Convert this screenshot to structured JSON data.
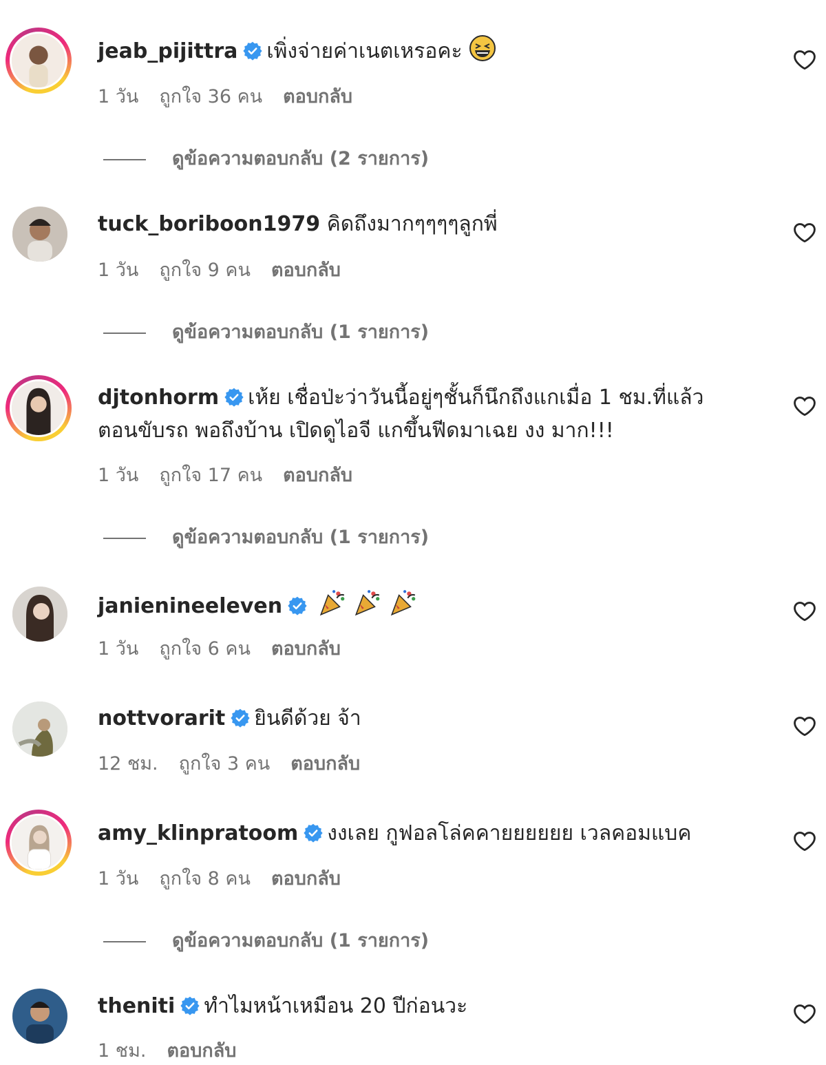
{
  "labels": {
    "reply": "ตอบกลับ"
  },
  "comments": [
    {
      "username": "jeab_pijittra",
      "verified": true,
      "text": "เพิ่งจ่ายค่าเนตเหรอคะ",
      "emoji": "laughing-tears",
      "time": "1 วัน",
      "likes": "ถูกใจ 36 คน",
      "replies": "ดูข้อความตอบกลับ (2 รายการ)"
    },
    {
      "username": "tuck_boriboon1979",
      "verified": false,
      "text": "คิดถึงมากๆๆๆๆลูกพี่",
      "time": "1 วัน",
      "likes": "ถูกใจ 9 คน",
      "replies": "ดูข้อความตอบกลับ (1 รายการ)"
    },
    {
      "username": "djtonhorm",
      "verified": true,
      "text": "เห้ย เชื่อป่ะว่าวันนี้อยู่ๆชั้นก็นึกถึงแกเมื่อ 1 ชม.ที่แล้ว",
      "text2": "ตอนขับรถ พอถึงบ้าน เปิดดูไอจี แกขึ้นฟีดมาเฉย งง มาก!!!",
      "time": "1 วัน",
      "likes": "ถูกใจ 17 คน",
      "replies": "ดูข้อความตอบกลับ (1 รายการ)"
    },
    {
      "username": "janienineeleven",
      "verified": true,
      "emoji": "party-popper x3",
      "time": "1 วัน",
      "likes": "ถูกใจ 6 คน"
    },
    {
      "username": "nottvorarit",
      "verified": true,
      "text": "ยินดีด้วย จ้า",
      "time": "12 ชม.",
      "likes": "ถูกใจ 3 คน"
    },
    {
      "username": "amy_klinpratoom",
      "verified": true,
      "text": "งงเลย กูฟอลโล่คคายยยยยย เวลคอมแบค",
      "time": "1 วัน",
      "likes": "ถูกใจ 8 คน",
      "replies": "ดูข้อความตอบกลับ (1 รายการ)"
    },
    {
      "username": "theniti",
      "verified": true,
      "text": "ทำไมหน้าเหมือน 20 ปีก่อนวะ",
      "time": "1 ชม."
    }
  ],
  "colors": {
    "verified": "#3897f0",
    "text": "#262626",
    "muted": "#737373"
  }
}
